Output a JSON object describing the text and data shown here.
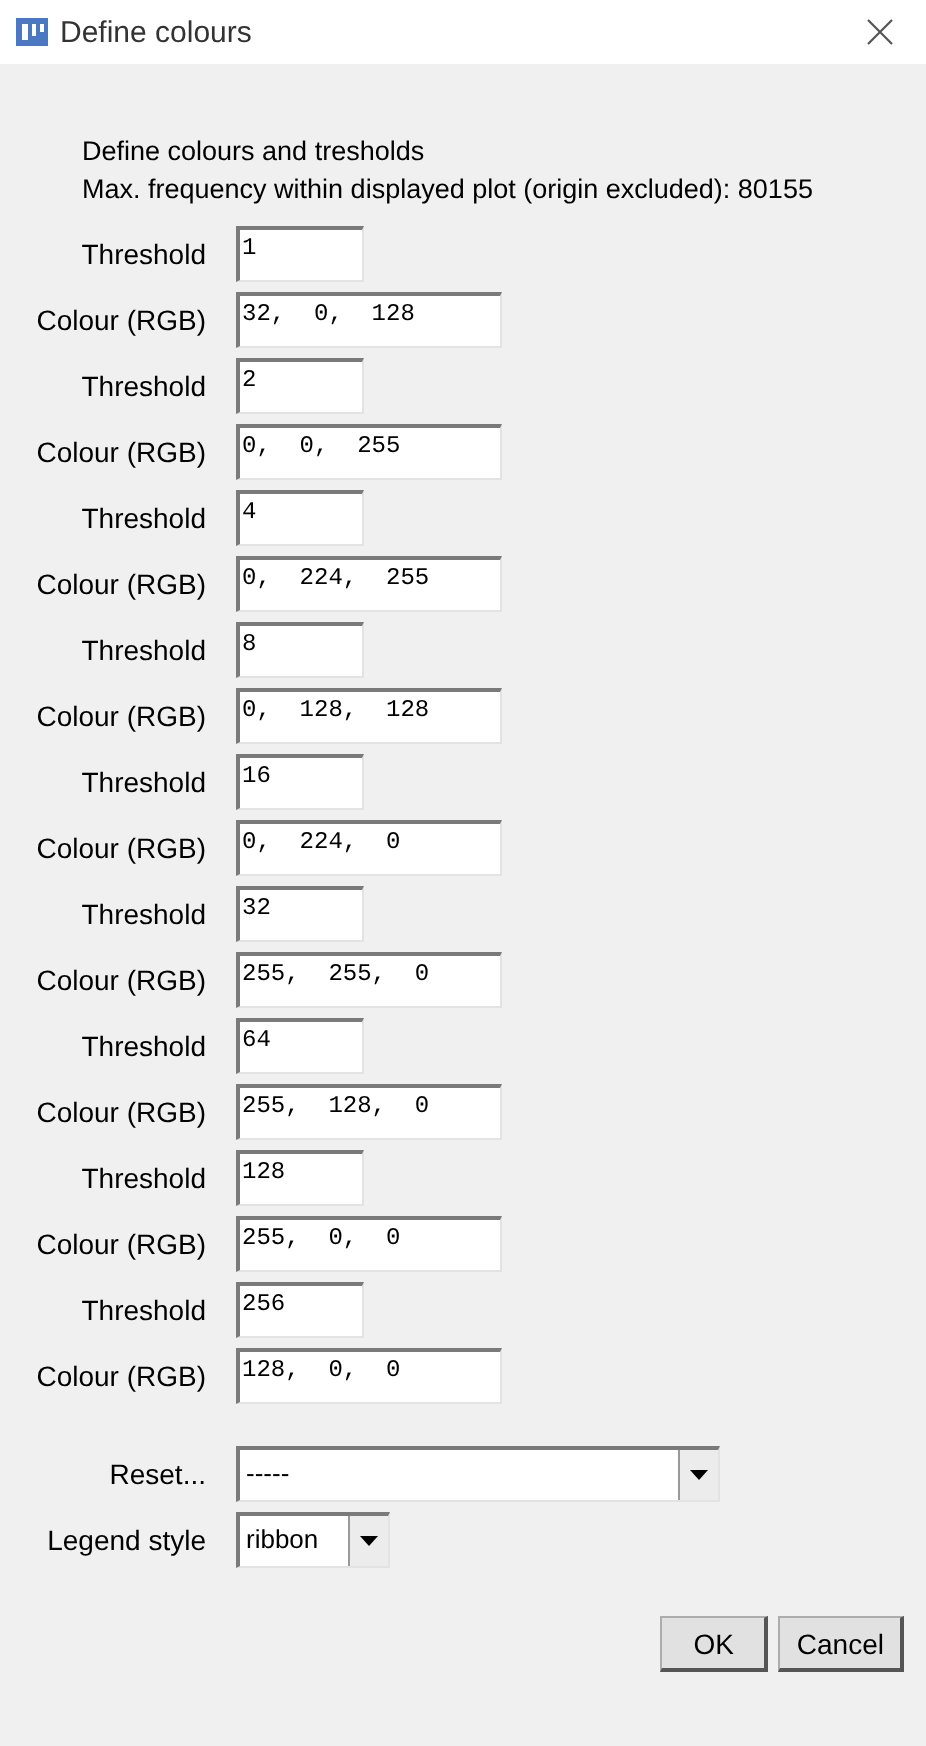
{
  "window": {
    "title": "Define colours"
  },
  "intro": [
    "Define colours and tresholds",
    "Max. frequency within displayed plot (origin excluded): 80155"
  ],
  "levels": [
    {
      "threshold_label": "Threshold",
      "threshold": "1",
      "colour_label": "Colour (RGB)",
      "colour": "32,  0,  128"
    },
    {
      "threshold_label": "Threshold",
      "threshold": "2",
      "colour_label": "Colour (RGB)",
      "colour": "0,  0,  255"
    },
    {
      "threshold_label": "Threshold",
      "threshold": "4",
      "colour_label": "Colour (RGB)",
      "colour": "0,  224,  255"
    },
    {
      "threshold_label": "Threshold",
      "threshold": "8",
      "colour_label": "Colour (RGB)",
      "colour": "0,  128,  128"
    },
    {
      "threshold_label": "Threshold",
      "threshold": "16",
      "colour_label": "Colour (RGB)",
      "colour": "0,  224,  0"
    },
    {
      "threshold_label": "Threshold",
      "threshold": "32",
      "colour_label": "Colour (RGB)",
      "colour": "255,  255,  0"
    },
    {
      "threshold_label": "Threshold",
      "threshold": "64",
      "colour_label": "Colour (RGB)",
      "colour": "255,  128,  0"
    },
    {
      "threshold_label": "Threshold",
      "threshold": "128",
      "colour_label": "Colour (RGB)",
      "colour": "255,  0,  0"
    },
    {
      "threshold_label": "Threshold",
      "threshold": "256",
      "colour_label": "Colour (RGB)",
      "colour": "128,  0,  0"
    }
  ],
  "reset": {
    "label": "Reset...",
    "value": "-----"
  },
  "legend_style": {
    "label": "Legend style",
    "value": "ribbon"
  },
  "buttons": [
    "OK",
    "Cancel"
  ]
}
